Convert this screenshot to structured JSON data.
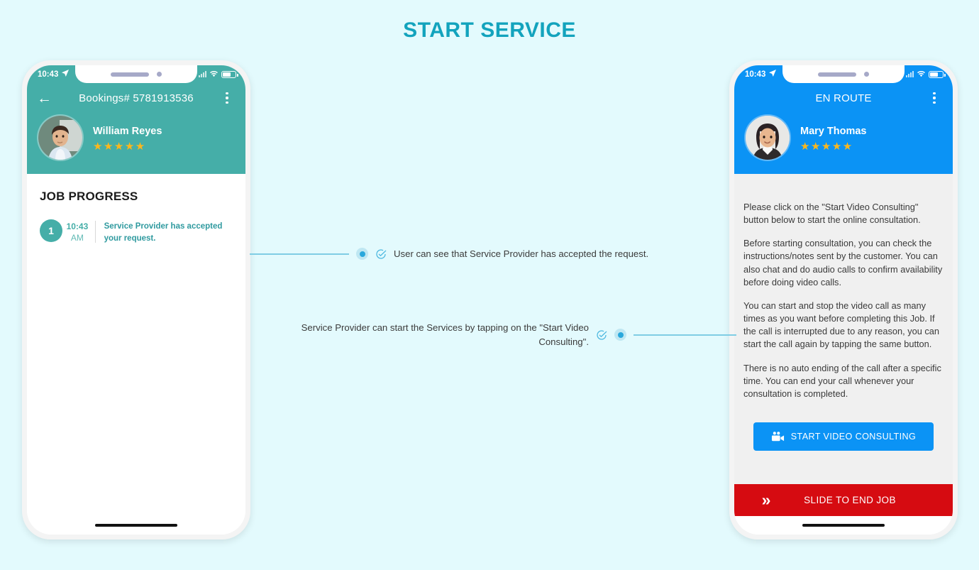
{
  "title": "START SERVICE",
  "theme": {
    "page_background": "#e3fafd",
    "title_color": "#13a3bd",
    "teal": "#45aea8",
    "blue": "#0b93f5",
    "red": "#d60b11",
    "star_gold": "#ffb71b",
    "callout_line": "#7fcde4",
    "callout_dot": "#29a8dc"
  },
  "left_phone": {
    "status_bar": {
      "time": "10:43",
      "location_icon": "location-arrow-icon",
      "signal_icon": "signal-bars-icon",
      "wifi_icon": "wifi-icon",
      "battery_icon": "battery-icon"
    },
    "header": {
      "back_icon": "back-arrow-icon",
      "title": "Bookings# 5781913536",
      "menu_icon": "kebab-menu-icon"
    },
    "user": {
      "name": "William Reyes",
      "rating_stars": "★★★★★",
      "rating_value": 5,
      "avatar_icon": "user-photo-avatar"
    },
    "section_title": "JOB PROGRESS",
    "progress_steps": [
      {
        "number": "1",
        "time": "10:43",
        "meridiem": "AM",
        "text": "Service Provider has accepted your request."
      }
    ]
  },
  "right_phone": {
    "status_bar": {
      "time": "10:43",
      "location_icon": "location-arrow-icon",
      "signal_icon": "signal-bars-icon",
      "wifi_icon": "wifi-icon",
      "battery_icon": "battery-icon"
    },
    "header": {
      "title": "EN ROUTE",
      "menu_icon": "kebab-menu-icon"
    },
    "user": {
      "name": "Mary Thomas",
      "rating_stars": "★★★★★",
      "rating_value": 5,
      "avatar_icon": "user-photo-avatar"
    },
    "notes": [
      "Please click on the \"Start Video Consulting\" button below to start the online consultation.",
      "Before starting consultation, you can check the instructions/notes sent by the customer. You can also chat and do audio calls to confirm availability before doing video calls.",
      "You can start and stop the video call as many times as you want before completing this Job. If the call is interrupted due to any reason, you can start the call again by tapping the same button.",
      "There is no auto ending of the call after a specific time. You can end your call whenever your consultation is completed."
    ],
    "cta_button": {
      "label": "START VIDEO CONSULTING",
      "icon": "video-camera-icon"
    },
    "slide_bar": {
      "label": "SLIDE TO END JOB",
      "icon": "double-chevron-right-icon"
    }
  },
  "callouts": [
    {
      "text": "User can see that Service Provider has accepted the request.",
      "icon": "check-circle-icon",
      "marker": "callout-dot"
    },
    {
      "text": "Service Provider can start the Services by tapping on the \"Start Video Consulting\".",
      "icon": "check-circle-icon",
      "marker": "callout-dot"
    }
  ]
}
